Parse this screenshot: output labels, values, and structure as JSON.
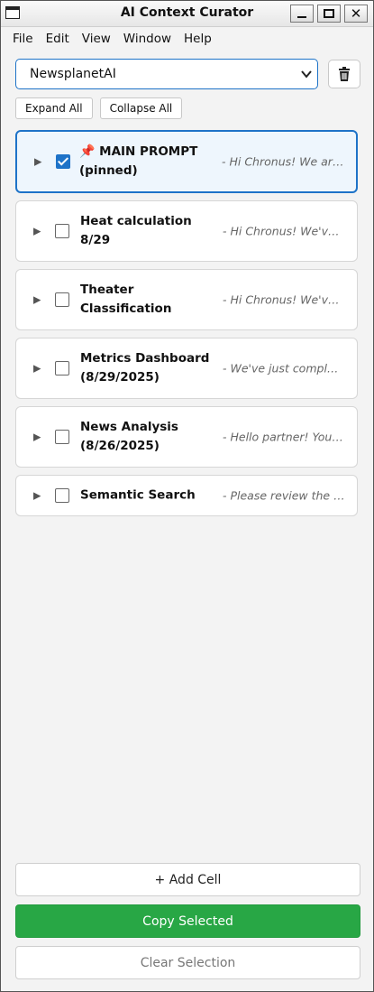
{
  "window": {
    "title": "AI Context Curator"
  },
  "menu": [
    "File",
    "Edit",
    "View",
    "Window",
    "Help"
  ],
  "project_select": {
    "value": "NewsplanetAI"
  },
  "controls": {
    "expand_all": "Expand All",
    "collapse_all": "Collapse All"
  },
  "cells": [
    {
      "pin": "📌",
      "title": "MAIN PROMPT (pinned)",
      "preview": "- Hi Chronus! We are…",
      "checked": true
    },
    {
      "title": "Heat calculation 8/29",
      "preview": "- Hi Chronus! We've …",
      "checked": false
    },
    {
      "title": "Theater Classification",
      "preview": "- Hi Chronus! We've …",
      "checked": false
    },
    {
      "title": "Metrics Dashboard (8/29/2025)",
      "preview": "- We've just complete…",
      "checked": false
    },
    {
      "title": "News Analysis (8/26/2025)",
      "preview": "- Hello partner! You'r…",
      "checked": false
    },
    {
      "title": "Semantic Search",
      "preview": "- Please review the f…",
      "checked": false
    }
  ],
  "actions": {
    "add": "+ Add Cell",
    "copy": "Copy Selected",
    "clear": "Clear Selection"
  },
  "colors": {
    "accent": "#1e73c8",
    "copy_button": "#28a745"
  }
}
